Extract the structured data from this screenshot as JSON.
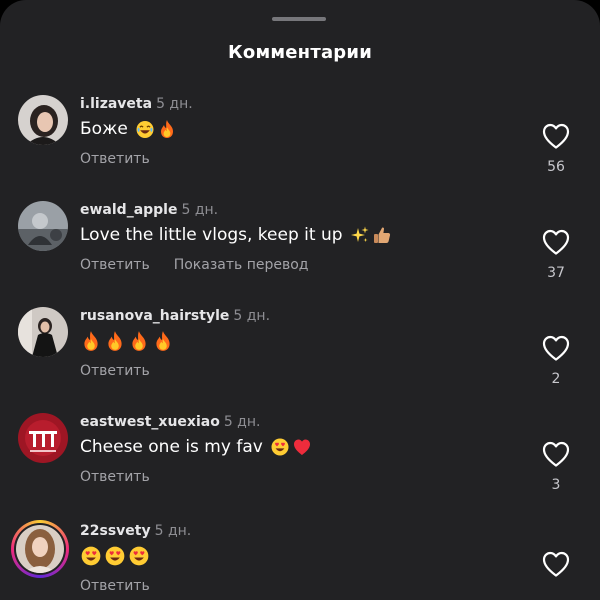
{
  "header": {
    "title": "Комментарии"
  },
  "comments": [
    {
      "username": "i.lizaveta",
      "time": "5 дн.",
      "text": "Боже",
      "emojis": [
        "laughing-face-emoji",
        "fire-emoji"
      ],
      "reply_label": "Ответить",
      "likes": "56"
    },
    {
      "username": "ewald_apple",
      "time": "5 дн.",
      "text": "Love the little vlogs, keep it up",
      "emojis": [
        "sparkles-emoji",
        "thumbs-up-emoji"
      ],
      "reply_label": "Ответить",
      "translate_label": "Показать перевод",
      "likes": "37"
    },
    {
      "username": "rusanova_hairstyle",
      "time": "5 дн.",
      "text": "",
      "emojis": [
        "fire-emoji",
        "fire-emoji",
        "fire-emoji",
        "fire-emoji"
      ],
      "reply_label": "Ответить",
      "likes": "2"
    },
    {
      "username": "eastwest_xuexiao",
      "time": "5 дн.",
      "text": "Cheese one is my fav",
      "emojis": [
        "heart-eyes-emoji",
        "red-heart-emoji"
      ],
      "reply_label": "Ответить",
      "likes": "3"
    },
    {
      "username": "22ssvety",
      "time": "5 дн.",
      "text": "",
      "emojis": [
        "heart-eyes-emoji",
        "heart-eyes-emoji",
        "heart-eyes-emoji"
      ],
      "reply_label": "Ответить",
      "likes": ""
    }
  ],
  "colors": {
    "background": "#222224",
    "text_primary": "#ffffff",
    "text_secondary": "#8e8e93",
    "like_outline": "#ffffff"
  }
}
